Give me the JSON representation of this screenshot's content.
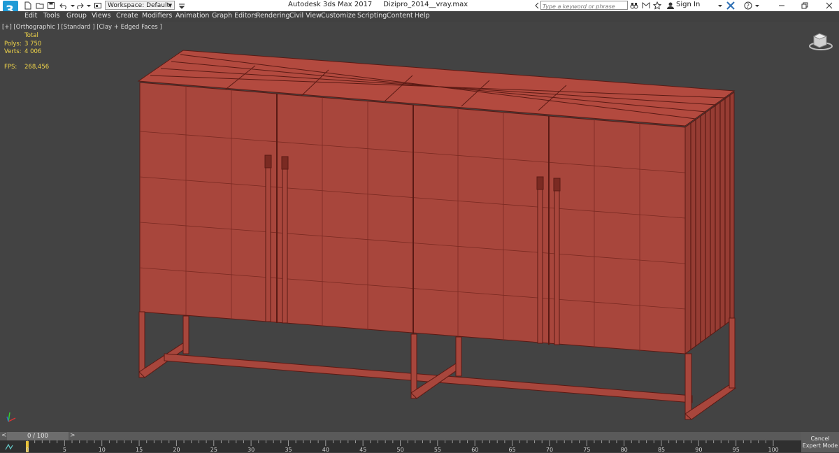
{
  "app": {
    "title": "Autodesk 3ds Max 2017",
    "file": "Dizipro_2014__vray.max",
    "logo_label": "3"
  },
  "toolbar": {
    "workspace_label": "Workspace: Default",
    "search_placeholder": "Type a keyword or phrase",
    "signin_label": "Sign In"
  },
  "menu": [
    "Edit",
    "Tools",
    "Group",
    "Views",
    "Create",
    "Modifiers",
    "Animation",
    "Graph Editors",
    "Rendering",
    "Civil View",
    "Customize",
    "Scripting",
    "Content",
    "Help"
  ],
  "viewport": {
    "label": "[+] [Orthographic ] [Standard ] [Clay + Edged Faces ]",
    "stats": {
      "header": "Total",
      "polys_label": "Polys:",
      "polys": "3 750",
      "verts_label": "Verts:",
      "verts": "4 006",
      "fps_label": "FPS:",
      "fps": "268,456"
    },
    "model_color": "#a8463c",
    "edge_color": "#5a1a14"
  },
  "timeline": {
    "frame_display": "0 / 100",
    "prev_label": "<",
    "next_label": ">",
    "ticks": [
      "0",
      "5",
      "10",
      "15",
      "20",
      "25",
      "30",
      "35",
      "40",
      "45",
      "50",
      "55",
      "60",
      "65",
      "70",
      "75",
      "80",
      "85",
      "90",
      "95",
      "100"
    ]
  },
  "status": {
    "cancel_expert_mode": "Cancel Expert Mode"
  },
  "colors": {
    "accent_blue": "#2d8fd6",
    "stats_yellow": "#f2d64a",
    "viewport_bg": "#434343"
  }
}
